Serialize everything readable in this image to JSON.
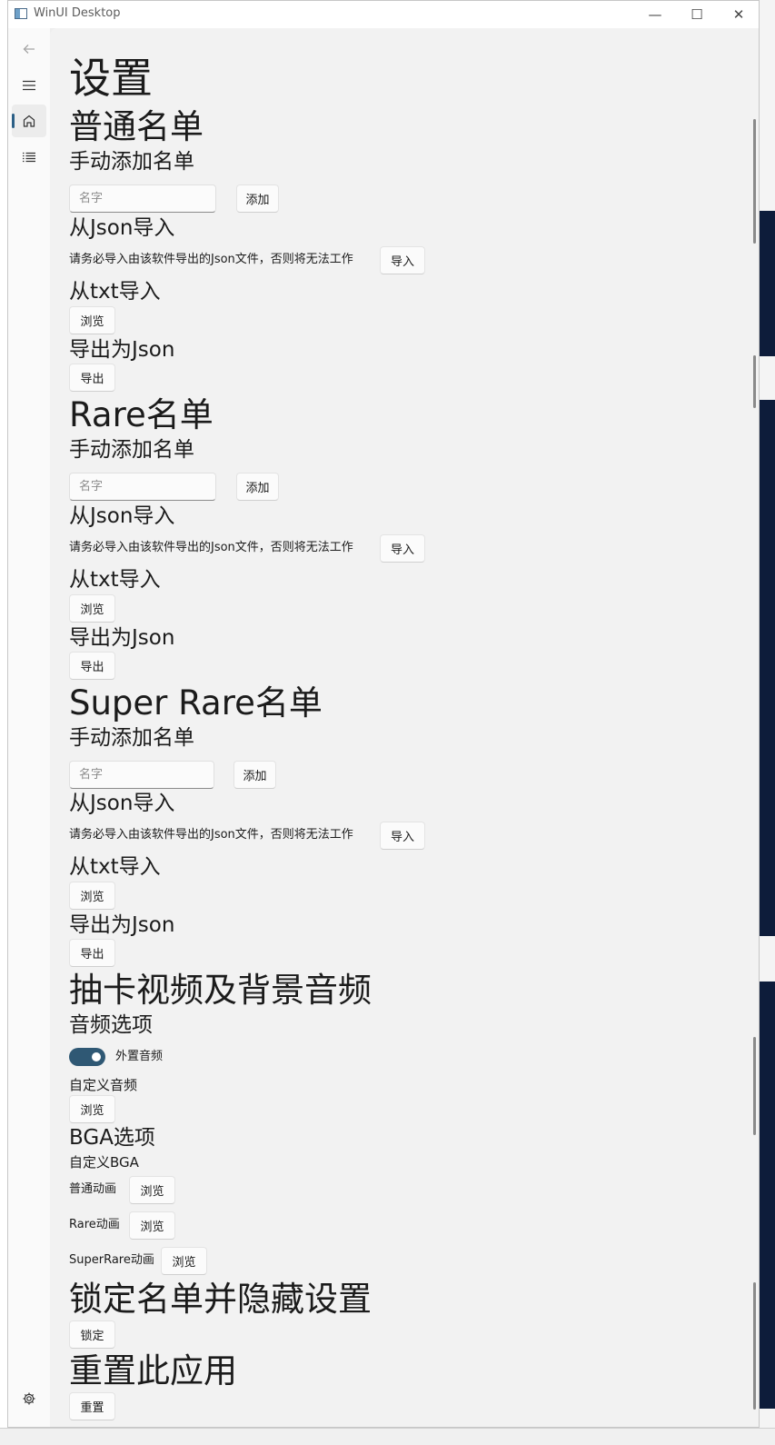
{
  "window": {
    "title": "WinUI Desktop"
  },
  "caption": {
    "minimize": "—",
    "maximize": "☐",
    "close": "✕"
  },
  "nav": {
    "items": [
      {
        "icon": "back-arrow-icon",
        "glyph": "←"
      },
      {
        "icon": "hamburger-menu-icon",
        "glyph": "☰"
      },
      {
        "icon": "home-icon",
        "glyph": "⌂"
      },
      {
        "icon": "list-icon",
        "glyph": "☷"
      },
      {
        "icon": "gear-icon",
        "glyph": "⚙"
      }
    ]
  },
  "settings": {
    "title": "设置",
    "common_list": {
      "heading": "普通名单",
      "manual_add": {
        "heading": "手动添加名单",
        "placeholder": "名字",
        "add_label": "添加"
      },
      "json_import": {
        "heading": "从Json导入",
        "note": "请务必导入由该软件导出的Json文件，否则将无法工作",
        "button": "导入"
      },
      "txt_import": {
        "heading": "从txt导入",
        "button": "浏览"
      },
      "export_json": {
        "heading": "导出为Json",
        "button": "导出"
      }
    },
    "rare_list": {
      "heading": "Rare名单",
      "manual_add": {
        "heading": "手动添加名单",
        "placeholder": "名字",
        "add_label": "添加"
      },
      "json_import": {
        "heading": "从Json导入",
        "note": "请务必导入由该软件导出的Json文件，否则将无法工作",
        "button": "导入"
      },
      "txt_import": {
        "heading": "从txt导入",
        "button": "浏览"
      },
      "export_json": {
        "heading": "导出为Json",
        "button": "导出"
      }
    },
    "super_rare_list": {
      "heading": "Super Rare名单",
      "manual_add": {
        "heading": "手动添加名单",
        "placeholder": "名字",
        "add_label": "添加"
      },
      "json_import": {
        "heading": "从Json导入",
        "note": "请务必导入由该软件导出的Json文件，否则将无法工作",
        "button": "导入"
      },
      "txt_import": {
        "heading": "从txt导入",
        "button": "浏览"
      },
      "export_json": {
        "heading": "导出为Json",
        "button": "导出"
      }
    },
    "media": {
      "heading": "抽卡视频及背景音频",
      "audio_options": "音频选项",
      "external_audio_label": "外置音频",
      "external_audio_on": true,
      "custom_audio": "自定义音频",
      "custom_audio_button": "浏览",
      "bga_options": "BGA选项",
      "custom_bga": "自定义BGA",
      "normal_anim": "普通动画",
      "normal_anim_button": "浏览",
      "rare_anim": "Rare动画",
      "rare_anim_button": "浏览",
      "super_rare_anim": "SuperRare动画",
      "super_rare_anim_button": "浏览"
    },
    "lock": {
      "heading": "锁定名单并隐藏设置",
      "button": "锁定"
    },
    "reset": {
      "heading": "重置此应用",
      "button": "重置"
    }
  },
  "colors": {
    "accent": "#2f5874",
    "content_bg": "#f2f2f2"
  }
}
